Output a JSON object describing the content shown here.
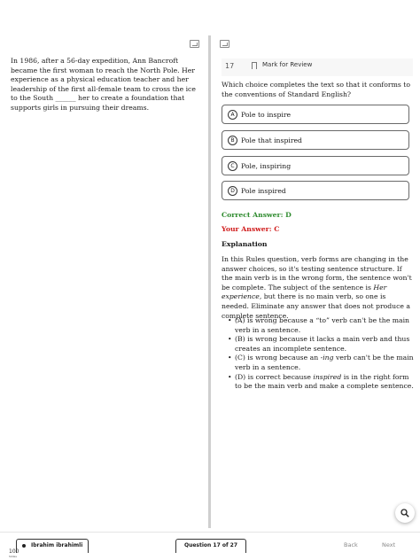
{
  "passage": {
    "text": "In 1986, after a 56-day expedition, Ann Bancroft became the first woman to reach the North Pole. Her experience as a physical education teacher and her leadership of the first all-female team to cross the ice to the South ______ her to create a foundation that supports girls in pursuing their dreams."
  },
  "question": {
    "number": "17",
    "mark_label": "Mark for Review",
    "prompt": "Which choice completes the text so that it conforms to the conventions of Standard English?",
    "choices": [
      {
        "letter": "A",
        "text": "Pole to inspire"
      },
      {
        "letter": "B",
        "text": "Pole that inspired"
      },
      {
        "letter": "C",
        "text": "Pole, inspiring"
      },
      {
        "letter": "D",
        "text": "Pole inspired"
      }
    ]
  },
  "answers": {
    "correct": "Correct Answer: D",
    "yours": "Your Answer: C"
  },
  "explanation": {
    "title": "Explanation",
    "body_before": "In this Rules question, verb forms are changing in the answer choices, so it's testing sentence structure. If the main verb is in the wrong form, the sentence won't be complete. The subject of the sentence is ",
    "body_italic": "Her experience",
    "body_after": ", but there is no main verb, so one is needed. Eliminate any answer that does not produce a complete sentence.",
    "bullets": {
      "a": "(A) is wrong because a “to” verb can't be the main verb in a sentence.",
      "b": "(B) is wrong because it lacks a main verb and thus creates an incomplete sentence.",
      "c_before": "(C) is wrong because an ",
      "c_italic": "-ing",
      "c_after": " verb can't be the main verb in a sentence.",
      "d_before": "(D) is correct because ",
      "d_italic": "inspired",
      "d_after": " is in the right form to be the main verb and make a complete sentence."
    }
  },
  "footer": {
    "user_name": "Ibrahim ibrahimli",
    "question_position": "Question 17 of 27",
    "back_label": "Back",
    "next_label": "Next",
    "zoom_level": "100",
    "zoom_caption": "Slides"
  },
  "icons": {
    "pane_toggle": "expand-pane-icon",
    "bookmark": "bookmark-icon",
    "zoom": "magnifier-icon",
    "user": "user-dot-icon"
  },
  "colors": {
    "correct": "#2e8b2e",
    "incorrect": "#d01c1c",
    "divider": "#cfcfcf"
  }
}
